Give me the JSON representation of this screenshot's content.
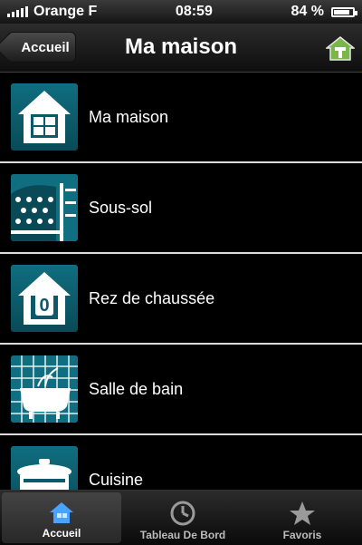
{
  "status": {
    "carrier": "Orange F",
    "time": "08:59",
    "battery": "84 %",
    "battery_level": 0.84
  },
  "nav": {
    "back_label": "Accueil",
    "title": "Ma maison",
    "home_icon": "home-button-icon"
  },
  "list": {
    "items": [
      {
        "label": "Ma maison",
        "icon": "house-icon"
      },
      {
        "label": "Sous-sol",
        "icon": "basement-icon"
      },
      {
        "label": "Rez de chaussée",
        "icon": "ground-floor-icon"
      },
      {
        "label": "Salle de bain",
        "icon": "bathroom-icon"
      },
      {
        "label": "Cuisine",
        "icon": "kitchen-icon"
      }
    ]
  },
  "tabs": [
    {
      "label": "Accueil",
      "icon": "home-icon",
      "active": true
    },
    {
      "label": "Tableau De Bord",
      "icon": "clock-icon",
      "active": false
    },
    {
      "label": "Favoris",
      "icon": "star-icon",
      "active": false
    }
  ],
  "colors": {
    "accent": "#0f6e80",
    "tile_dark": "#0a4a57",
    "home_green": "#7ab648"
  }
}
